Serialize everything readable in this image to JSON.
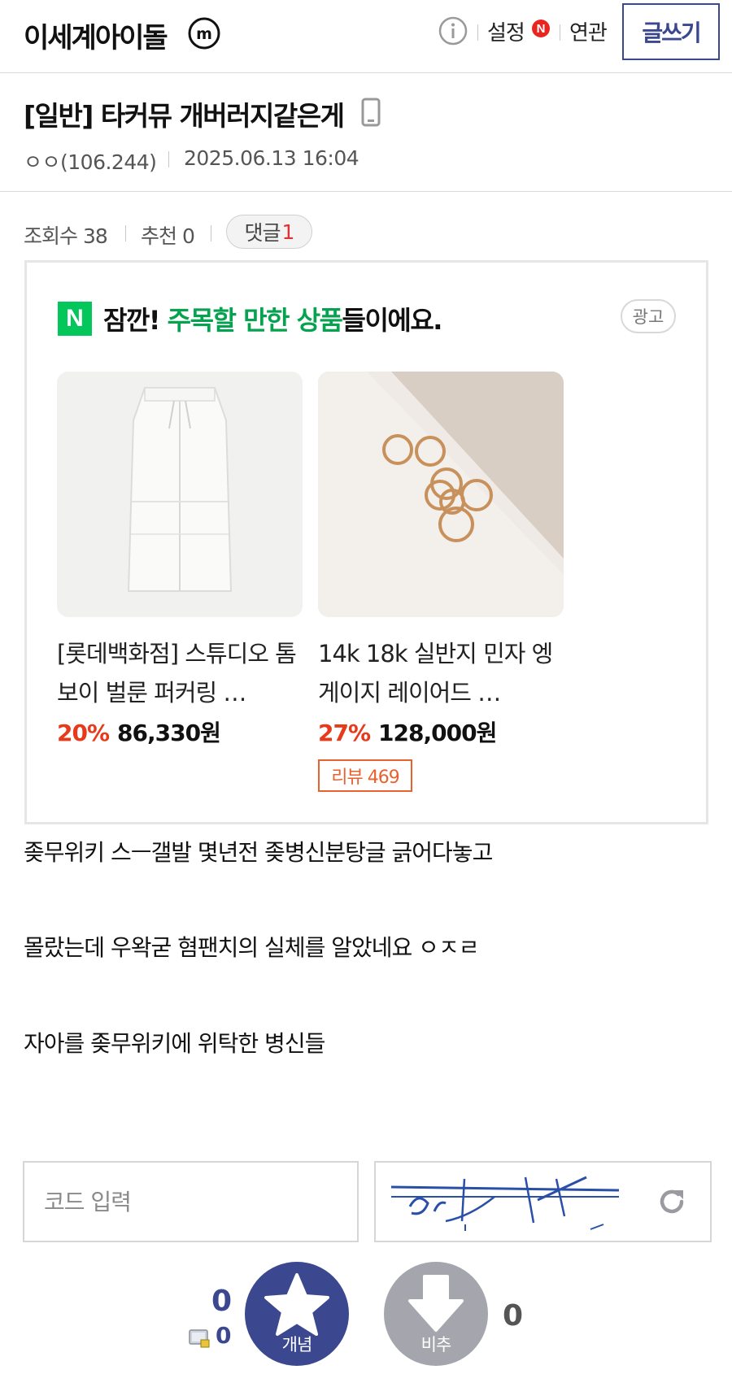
{
  "header": {
    "gallery_name": "이세계아이돌",
    "minor_badge": "m",
    "settings_label": "설정",
    "settings_new_badge": "N",
    "related_label": "연관",
    "write_label": "글쓰기"
  },
  "post": {
    "title": "[일반] 타커뮤 개버러지같은게",
    "author": "ㅇㅇ(106.244)",
    "date": "2025.06.13 16:04",
    "views_label": "조회수 38",
    "recommend_label": "추천 0",
    "comment_label": "댓글",
    "comment_count": "1",
    "body": [
      "좆무위키 스ㅡ갤발 몇년전 좆병신분탕글 긁어다놓고",
      "몰랐는데 우왁굳 혐팬치의 실체를 알았네요 ㅇㅈㄹ",
      "자아를 좆무위키에 위탁한 병신들"
    ]
  },
  "ad": {
    "logo": "N",
    "heading_prefix": "잠깐! ",
    "heading_highlight": "주목할 만한 상품",
    "heading_suffix": "들이에요.",
    "label": "광고",
    "products": [
      {
        "name": "[롯데백화점] 스튜디오 톰보이 벌룬 퍼커링 …",
        "discount": "20%",
        "price": "86,330원"
      },
      {
        "name": "14k 18k 실반지 민자 엥게이지 레이어드 …",
        "discount": "27%",
        "price": "128,000원",
        "review": "리뷰 469"
      }
    ]
  },
  "captcha": {
    "placeholder": "코드 입력"
  },
  "votes": {
    "up_count": "0",
    "fixed_count": "0",
    "up_label": "개념",
    "down_label": "비추",
    "down_count": "0"
  },
  "colors": {
    "brand": "#3b4890",
    "naver_green": "#03c75a",
    "discount_red": "#e8391a",
    "comment_red": "#dd3333"
  }
}
